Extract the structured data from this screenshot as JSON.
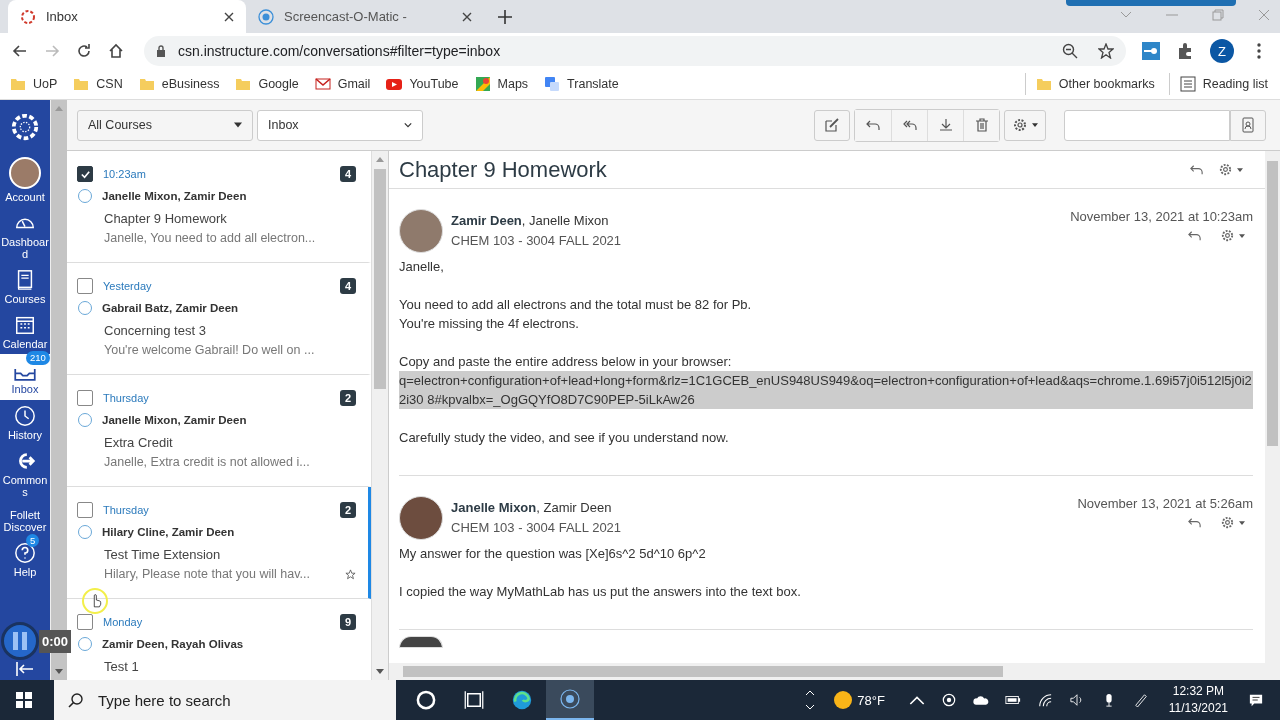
{
  "browser": {
    "tabs": [
      {
        "title": "Inbox",
        "selected": true
      },
      {
        "title": "Screencast-O-Matic -",
        "selected": false
      }
    ],
    "url": "csn.instructure.com/conversations#filter=type=inbox",
    "profile_initial": "Z",
    "bookmarks": [
      {
        "label": "UoP",
        "kind": "folder"
      },
      {
        "label": "CSN",
        "kind": "folder"
      },
      {
        "label": "eBusiness",
        "kind": "folder"
      },
      {
        "label": "Google",
        "kind": "folder"
      },
      {
        "label": "Gmail",
        "kind": "gmail"
      },
      {
        "label": "YouTube",
        "kind": "youtube"
      },
      {
        "label": "Maps",
        "kind": "maps"
      },
      {
        "label": "Translate",
        "kind": "translate"
      }
    ],
    "other_bookmarks": "Other bookmarks",
    "reading_list": "Reading list"
  },
  "nav": {
    "items": [
      {
        "label": "Account",
        "kind": "account",
        "selected": false
      },
      {
        "label": "Dashboard",
        "kind": "dashboard",
        "selected": false
      },
      {
        "label": "Courses",
        "kind": "courses",
        "selected": false
      },
      {
        "label": "Calendar",
        "kind": "calendar",
        "selected": false
      },
      {
        "label": "Inbox",
        "kind": "inbox",
        "selected": true,
        "badge": "210"
      },
      {
        "label": "History",
        "kind": "history",
        "selected": false
      },
      {
        "label": "Commons",
        "kind": "commons",
        "selected": false
      },
      {
        "label": "Follett Discover",
        "kind": "none",
        "selected": false
      },
      {
        "label": "Help",
        "kind": "help",
        "selected": false,
        "badge": "5"
      }
    ]
  },
  "filters": {
    "course": "All Courses",
    "mailbox": "Inbox"
  },
  "conversations": [
    {
      "date": "10:23am",
      "checked": true,
      "participants": "Janelle Mixon, Zamir Deen",
      "subject": "Chapter 9 Homework",
      "preview": "Janelle, You need to add all electron...",
      "count": "4",
      "selected": false
    },
    {
      "date": "Yesterday",
      "checked": false,
      "participants": "Gabrail Batz, Zamir Deen",
      "subject": "Concerning test 3",
      "preview": "You're welcome Gabrail! Do well on ...",
      "count": "4",
      "selected": false
    },
    {
      "date": "Thursday",
      "checked": false,
      "participants": "Janelle Mixon, Zamir Deen",
      "subject": "Extra Credit",
      "preview": "Janelle, Extra credit is not allowed i...",
      "count": "2",
      "selected": false
    },
    {
      "date": "Thursday",
      "checked": false,
      "participants": "Hilary Cline, Zamir Deen",
      "subject": "Test Time Extension",
      "preview": "Hilary, Please note that you will hav...",
      "count": "2",
      "selected": true
    },
    {
      "date": "Monday",
      "checked": false,
      "participants": "Zamir Deen, Rayah Olivas",
      "subject": "Test 1",
      "count": "9",
      "selected": false
    }
  ],
  "thread": {
    "subject": "Chapter 9 Homework",
    "messages": [
      {
        "author": "Zamir Deen",
        "recipients": ", Janelle Mixon",
        "course": "CHEM 103 - 3004 FALL 2021",
        "date": "November 13, 2021 at 10:23am",
        "paragraphs": [
          [
            {
              "text": "Janelle,",
              "highlighted": false
            }
          ],
          [
            {
              "text": "You need to add all electrons and the total must be 82 for Pb.",
              "highlighted": false
            },
            {
              "text": "You're missing the 4f electrons.",
              "highlighted": false
            }
          ],
          [
            {
              "text": "Copy and paste the entire address below in your browser:",
              "highlighted": false
            },
            {
              "text": "q=electron+configuration+of+lead+long+form&rlz=1C1GCEB_enUS948US949&oq=electron+configuration+of+lead&aqs=chrome.1.69i57j0i512l5j0i22i30 8#kpvalbx=_OgGQYfO8D7C90PEP-5iLkAw26",
              "highlighted": true
            }
          ],
          [
            {
              "text": "Carefully study the video, and see if you understand now.",
              "highlighted": false
            }
          ]
        ]
      },
      {
        "author": "Janelle Mixon",
        "recipients": ", Zamir Deen",
        "course": "CHEM 103 - 3004 FALL 2021",
        "date": "November 13, 2021 at 5:26am",
        "paragraphs": [
          [
            {
              "text": "My answer for the question was [Xe]6s^2 5d^10 6p^2",
              "highlighted": false
            }
          ],
          [
            {
              "text": "I copied the way MyMathLab has us put the answers into the text box.",
              "highlighted": false
            }
          ]
        ]
      }
    ]
  },
  "recorder": {
    "timer": "0:00"
  },
  "taskbar": {
    "search_placeholder": "Type here to search",
    "weather": "78°F",
    "time": "12:32 PM",
    "date": "11/13/2021"
  }
}
